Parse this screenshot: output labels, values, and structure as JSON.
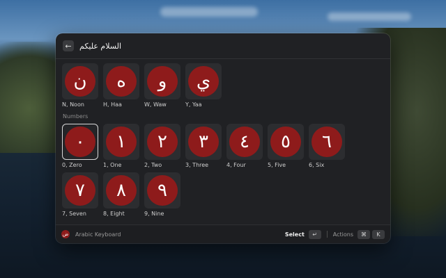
{
  "search": {
    "value": "السلام عليكم"
  },
  "letters": [
    {
      "glyph": "ن",
      "caption": "N, Noon"
    },
    {
      "glyph": "ه",
      "caption": "H, Haa"
    },
    {
      "glyph": "و",
      "caption": "W, Waw"
    },
    {
      "glyph": "ي",
      "caption": "Y, Yaa"
    }
  ],
  "numbers_section": {
    "label": "Numbers",
    "items": [
      {
        "glyph": "٠",
        "caption": "0, Zero"
      },
      {
        "glyph": "١",
        "caption": "1, One"
      },
      {
        "glyph": "٢",
        "caption": "2, Two"
      },
      {
        "glyph": "٣",
        "caption": "3, Three"
      },
      {
        "glyph": "٤",
        "caption": "4, Four"
      },
      {
        "glyph": "٥",
        "caption": "5, Five"
      },
      {
        "glyph": "٦",
        "caption": "6, Six"
      },
      {
        "glyph": "٧",
        "caption": "7, Seven"
      },
      {
        "glyph": "٨",
        "caption": "8, Eight"
      },
      {
        "glyph": "٩",
        "caption": "9, Nine"
      }
    ]
  },
  "footer": {
    "app_icon_glyph": "ض",
    "app_name": "Arabic Keyboard",
    "select_label": "Select",
    "enter_key": "↵",
    "actions_label": "Actions",
    "cmd_key": "⌘",
    "k_key": "K"
  },
  "colors": {
    "accent_circle": "#8e1b1b",
    "window_bg": "#202124"
  }
}
